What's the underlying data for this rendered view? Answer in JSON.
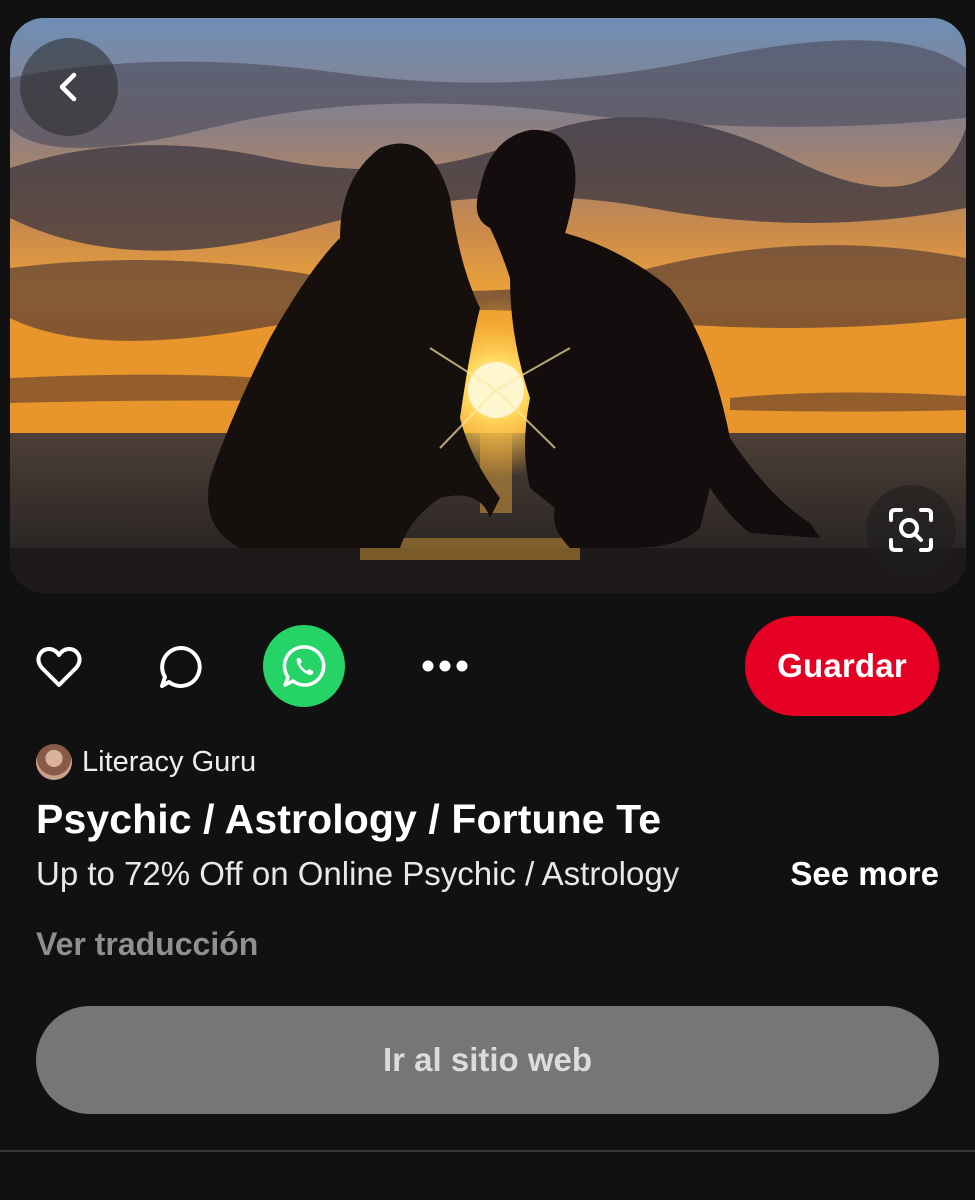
{
  "pin": {
    "image_alt": "Couple kissing silhouette at sunset over the sea"
  },
  "actions": {
    "save_label": "Guardar"
  },
  "creator": {
    "name": "Literacy Guru"
  },
  "title": "Psychic / Astrology / Fortune Te",
  "description": "Up to 72% Off on Online Psychic / Astrology",
  "see_more_label": "See more",
  "translate_label": "Ver traducción",
  "visit_label": "Ir al sitio web",
  "colors": {
    "background": "#111111",
    "save": "#e60023",
    "whatsapp": "#25d366",
    "visit_button": "#767676"
  },
  "icons": [
    "back-icon",
    "visual-search-icon",
    "heart-icon",
    "comment-icon",
    "whatsapp-icon",
    "more-icon"
  ]
}
